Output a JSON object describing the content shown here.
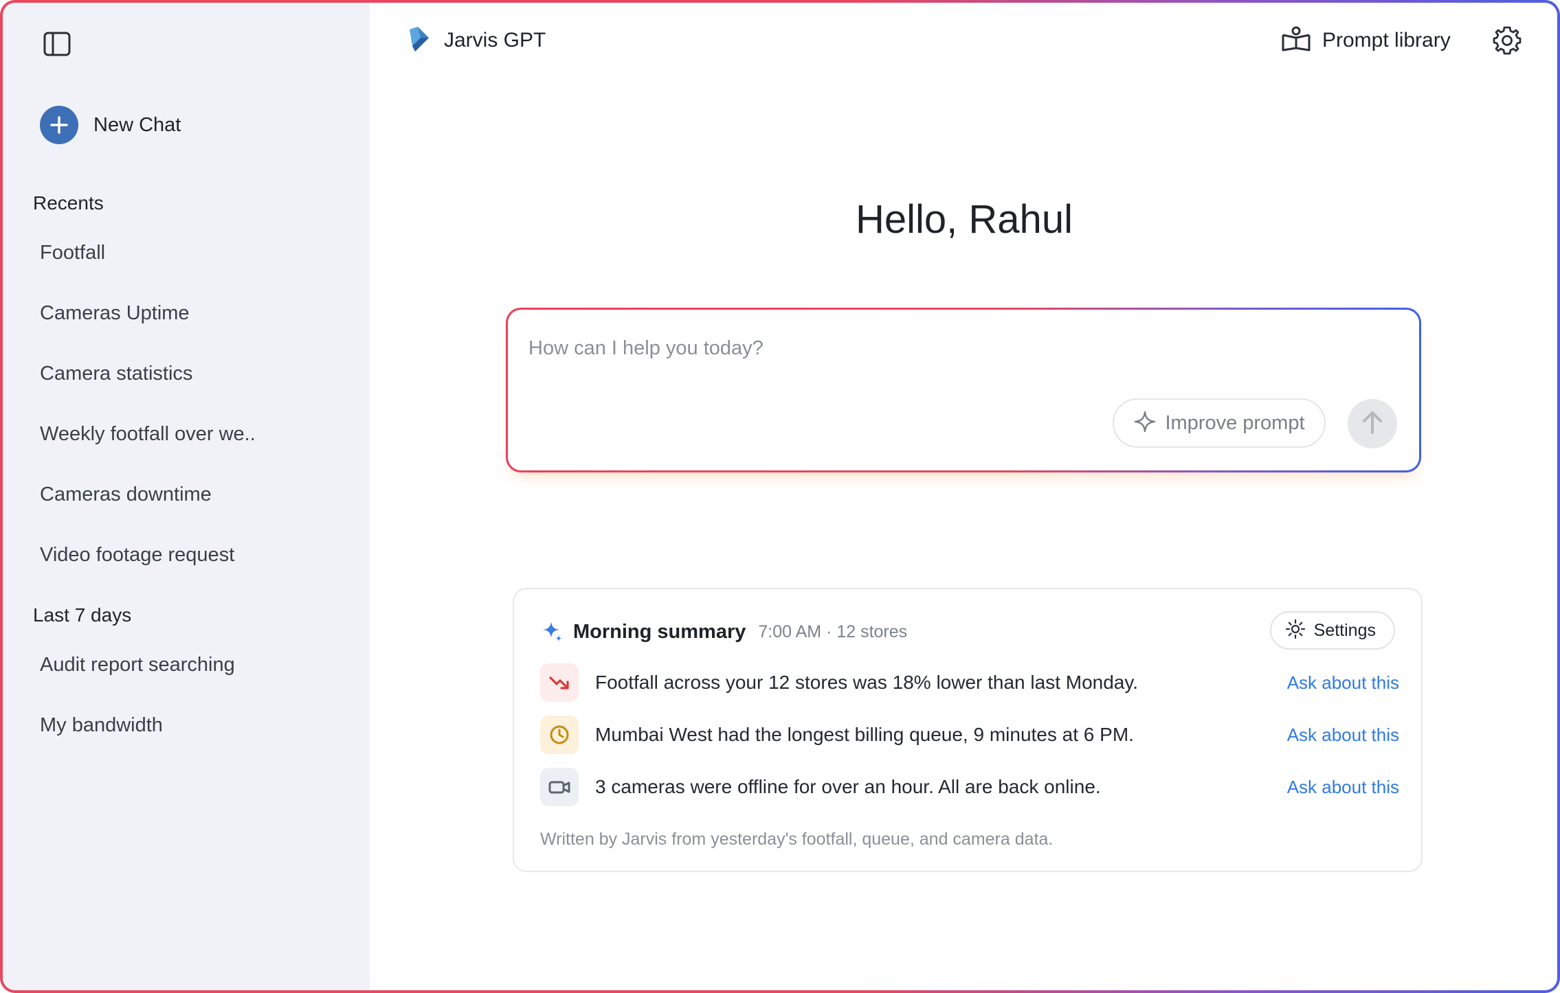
{
  "app": {
    "name": "Jarvis GPT"
  },
  "sidebar": {
    "new_chat_label": "New Chat",
    "recents_title": "Recents",
    "recents": [
      {
        "label": "Footfall"
      },
      {
        "label": "Cameras Uptime"
      },
      {
        "label": "Camera statistics"
      },
      {
        "label": "Weekly footfall over we.."
      },
      {
        "label": "Cameras downtime"
      },
      {
        "label": "Video footage request"
      }
    ],
    "last7_title": "Last 7 days",
    "last7": [
      {
        "label": "Audit report searching"
      },
      {
        "label": "My bandwidth"
      }
    ]
  },
  "header": {
    "prompt_library_label": "Prompt library"
  },
  "main": {
    "greeting": "Hello, Rahul",
    "prompt": {
      "placeholder": "How can I help you today?",
      "value": "",
      "improve_label": "Improve prompt"
    },
    "summary": {
      "title": "Morning summary",
      "meta": "7:00 AM · 12 stores",
      "settings_label": "Settings",
      "items": [
        {
          "icon": "trend-down-icon",
          "text": "Footfall across your 12 stores was 18% lower than last Monday.",
          "link": "Ask about this"
        },
        {
          "icon": "clock-icon",
          "text": "Mumbai West had the longest billing queue, 9 minutes at 6 PM.",
          "link": "Ask about this"
        },
        {
          "icon": "video-camera-icon",
          "text": "3 cameras were offline for over an hour. All are back online.",
          "link": "Ask about this"
        }
      ],
      "footnote": "Written by Jarvis from yesterday's footfall, queue, and camera data."
    }
  },
  "colors": {
    "accent_blue": "#3d6fb6",
    "link_blue": "#2f7be0",
    "gradient_start": "#e8475f",
    "gradient_end": "#4f5fe0",
    "sidebar_bg": "#f0f2f7",
    "red_badge_bg": "#fdecec",
    "amber_badge_bg": "#fdf1dc",
    "gray_badge_bg": "#eceff3"
  }
}
